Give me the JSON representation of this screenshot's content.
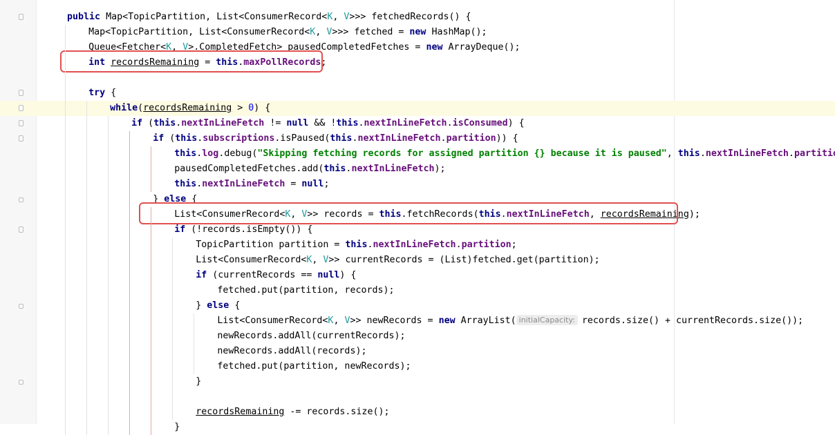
{
  "editor": {
    "lines": [
      {
        "indent": 4,
        "tokens": [
          {
            "t": "public",
            "c": "kw"
          },
          {
            "t": " Map<TopicPartition, List<ConsumerRecord<"
          },
          {
            "t": "K",
            "c": "tp"
          },
          {
            "t": ", "
          },
          {
            "t": "V",
            "c": "tp"
          },
          {
            "t": ">>> fetchedRecords() {"
          }
        ]
      },
      {
        "indent": 8,
        "tokens": [
          {
            "t": "Map<TopicPartition, List<ConsumerRecord<"
          },
          {
            "t": "K",
            "c": "tp"
          },
          {
            "t": ", "
          },
          {
            "t": "V",
            "c": "tp"
          },
          {
            "t": ">>> fetched = "
          },
          {
            "t": "new",
            "c": "kw"
          },
          {
            "t": " HashMap();"
          }
        ]
      },
      {
        "indent": 8,
        "tokens": [
          {
            "t": "Queue<Fetcher<"
          },
          {
            "t": "K",
            "c": "tp"
          },
          {
            "t": ", "
          },
          {
            "t": "V",
            "c": "tp"
          },
          {
            "t": ">.CompletedFetch> pausedCompletedFetches = "
          },
          {
            "t": "new",
            "c": "kw"
          },
          {
            "t": " ArrayDeque();"
          }
        ]
      },
      {
        "indent": 8,
        "tokens": [
          {
            "t": "int",
            "c": "kw"
          },
          {
            "t": " "
          },
          {
            "t": "recordsRemaining",
            "c": "u"
          },
          {
            "t": " = "
          },
          {
            "t": "this",
            "c": "kw"
          },
          {
            "t": "."
          },
          {
            "t": "maxPollRecords",
            "c": "fld"
          },
          {
            "t": ";"
          }
        ]
      },
      {
        "indent": 0,
        "tokens": []
      },
      {
        "indent": 8,
        "tokens": [
          {
            "t": "try",
            "c": "kw"
          },
          {
            "t": " {"
          }
        ]
      },
      {
        "indent": 12,
        "tokens": [
          {
            "t": "while",
            "c": "kw"
          },
          {
            "t": "("
          },
          {
            "t": "recordsRemaining",
            "c": "u"
          },
          {
            "t": " > "
          },
          {
            "t": "0",
            "c": "num"
          },
          {
            "t": ") {"
          }
        ]
      },
      {
        "indent": 16,
        "tokens": [
          {
            "t": "if",
            "c": "kw"
          },
          {
            "t": " ("
          },
          {
            "t": "this",
            "c": "kw"
          },
          {
            "t": "."
          },
          {
            "t": "nextInLineFetch",
            "c": "fld"
          },
          {
            "t": " != "
          },
          {
            "t": "null",
            "c": "kw"
          },
          {
            "t": " && !"
          },
          {
            "t": "this",
            "c": "kw"
          },
          {
            "t": "."
          },
          {
            "t": "nextInLineFetch",
            "c": "fld"
          },
          {
            "t": "."
          },
          {
            "t": "isConsumed",
            "c": "fld"
          },
          {
            "t": ") {"
          }
        ]
      },
      {
        "indent": 20,
        "tokens": [
          {
            "t": "if",
            "c": "kw"
          },
          {
            "t": " ("
          },
          {
            "t": "this",
            "c": "kw"
          },
          {
            "t": "."
          },
          {
            "t": "subscriptions",
            "c": "fld"
          },
          {
            "t": ".isPaused("
          },
          {
            "t": "this",
            "c": "kw"
          },
          {
            "t": "."
          },
          {
            "t": "nextInLineFetch",
            "c": "fld"
          },
          {
            "t": "."
          },
          {
            "t": "partition",
            "c": "fld"
          },
          {
            "t": ")) {"
          }
        ]
      },
      {
        "indent": 24,
        "tokens": [
          {
            "t": "this",
            "c": "kw"
          },
          {
            "t": "."
          },
          {
            "t": "log",
            "c": "fld"
          },
          {
            "t": ".debug("
          },
          {
            "t": "\"Skipping fetching records for assigned partition {} because it is paused\"",
            "c": "str"
          },
          {
            "t": ", "
          },
          {
            "t": "this",
            "c": "kw"
          },
          {
            "t": "."
          },
          {
            "t": "nextInLineFetch",
            "c": "fld"
          },
          {
            "t": "."
          },
          {
            "t": "partition",
            "c": "fld"
          },
          {
            "t": ");"
          }
        ]
      },
      {
        "indent": 24,
        "tokens": [
          {
            "t": "pausedCompletedFetches.add("
          },
          {
            "t": "this",
            "c": "kw"
          },
          {
            "t": "."
          },
          {
            "t": "nextInLineFetch",
            "c": "fld"
          },
          {
            "t": ");"
          }
        ]
      },
      {
        "indent": 24,
        "tokens": [
          {
            "t": "this",
            "c": "kw"
          },
          {
            "t": "."
          },
          {
            "t": "nextInLineFetch",
            "c": "fld"
          },
          {
            "t": " = "
          },
          {
            "t": "null",
            "c": "kw"
          },
          {
            "t": ";"
          }
        ]
      },
      {
        "indent": 20,
        "tokens": [
          {
            "t": "} "
          },
          {
            "t": "else",
            "c": "kw"
          },
          {
            "t": " {"
          }
        ]
      },
      {
        "indent": 24,
        "tokens": [
          {
            "t": "List<ConsumerRecord<"
          },
          {
            "t": "K",
            "c": "tp"
          },
          {
            "t": ", "
          },
          {
            "t": "V",
            "c": "tp"
          },
          {
            "t": ">> records = "
          },
          {
            "t": "this",
            "c": "kw"
          },
          {
            "t": ".fetchRecords("
          },
          {
            "t": "this",
            "c": "kw"
          },
          {
            "t": "."
          },
          {
            "t": "nextInLineFetch",
            "c": "fld"
          },
          {
            "t": ", "
          },
          {
            "t": "recordsRemaining",
            "c": "u"
          },
          {
            "t": ");"
          }
        ]
      },
      {
        "indent": 24,
        "tokens": [
          {
            "t": "if",
            "c": "kw"
          },
          {
            "t": " (!records.isEmpty()) {"
          }
        ]
      },
      {
        "indent": 28,
        "tokens": [
          {
            "t": "TopicPartition partition = "
          },
          {
            "t": "this",
            "c": "kw"
          },
          {
            "t": "."
          },
          {
            "t": "nextInLineFetch",
            "c": "fld"
          },
          {
            "t": "."
          },
          {
            "t": "partition",
            "c": "fld"
          },
          {
            "t": ";"
          }
        ]
      },
      {
        "indent": 28,
        "tokens": [
          {
            "t": "List<ConsumerRecord<"
          },
          {
            "t": "K",
            "c": "tp"
          },
          {
            "t": ", "
          },
          {
            "t": "V",
            "c": "tp"
          },
          {
            "t": ">> currentRecords = (List)fetched.get(partition);"
          }
        ]
      },
      {
        "indent": 28,
        "tokens": [
          {
            "t": "if",
            "c": "kw"
          },
          {
            "t": " (currentRecords == "
          },
          {
            "t": "null",
            "c": "kw"
          },
          {
            "t": ") {"
          }
        ]
      },
      {
        "indent": 32,
        "tokens": [
          {
            "t": "fetched.put(partition, records);"
          }
        ]
      },
      {
        "indent": 28,
        "tokens": [
          {
            "t": "} "
          },
          {
            "t": "else",
            "c": "kw"
          },
          {
            "t": " {"
          }
        ]
      },
      {
        "indent": 32,
        "tokens": [
          {
            "t": "List<ConsumerRecord<"
          },
          {
            "t": "K",
            "c": "tp"
          },
          {
            "t": ", "
          },
          {
            "t": "V",
            "c": "tp"
          },
          {
            "t": ">> newRecords = "
          },
          {
            "t": "new",
            "c": "kw"
          },
          {
            "t": " ArrayList("
          },
          {
            "t": "initialCapacity:",
            "c": "hint"
          },
          {
            "t": "records.size() + currentRecords.size());"
          }
        ]
      },
      {
        "indent": 32,
        "tokens": [
          {
            "t": "newRecords.addAll(currentRecords);"
          }
        ]
      },
      {
        "indent": 32,
        "tokens": [
          {
            "t": "newRecords.addAll(records);"
          }
        ]
      },
      {
        "indent": 32,
        "tokens": [
          {
            "t": "fetched.put(partition, newRecords);"
          }
        ]
      },
      {
        "indent": 28,
        "tokens": [
          {
            "t": "}"
          }
        ]
      },
      {
        "indent": 0,
        "tokens": []
      },
      {
        "indent": 28,
        "tokens": [
          {
            "t": "recordsRemaining",
            "c": "u"
          },
          {
            "t": " -= records.size();"
          }
        ]
      },
      {
        "indent": 24,
        "tokens": [
          {
            "t": "}"
          }
        ]
      }
    ]
  },
  "colors": {
    "keyword": "#000080",
    "field": "#660e7a",
    "type_param": "#20999d",
    "number": "#0000ff",
    "string": "#008000",
    "current_line": "#fdfbe2",
    "annotation_box": "#e0504f"
  }
}
